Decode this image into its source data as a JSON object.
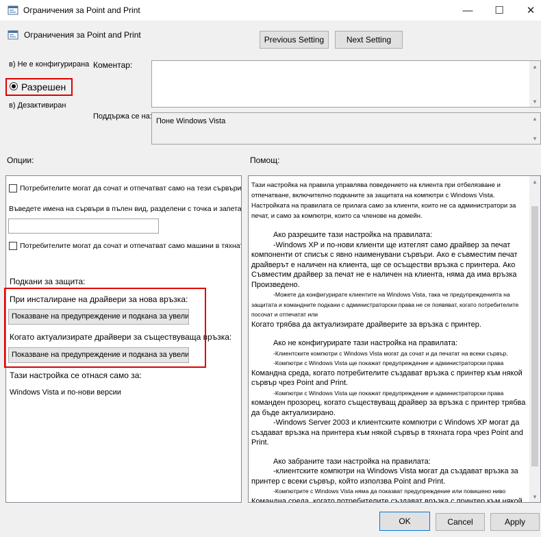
{
  "window": {
    "title": "Ограничения за Point and Print",
    "controls": {
      "minimize": "—",
      "maximize": "☐",
      "close": "✕"
    }
  },
  "header": {
    "setting_name": "Ограничения за Point and Print",
    "previous_label": "Previous Setting",
    "next_label": "Next Setting"
  },
  "state": {
    "not_configured": "в) Не е конфигурирана",
    "enabled": "Разрешен",
    "disabled": "в) Дезактивиран",
    "selected": "enabled"
  },
  "comment": {
    "label": "Коментар:",
    "value": ""
  },
  "supported": {
    "label": "Поддържа се на:",
    "value": "Поне Windows Vista"
  },
  "options": {
    "label": "Опции:",
    "check1": "Потребителите могат да сочат и отпечатват само на тези сървъри:",
    "servers_label": "Въведете имена на сървъри в пълен вид, разделени с точка и запетая",
    "servers_value": "",
    "check2": "Потребителите могат да сочат и отпечатват само машини в тяхната гора",
    "prompts_label": "Подкани за защита:",
    "new_conn_label": "При инсталиране на драйвери за нова връзка:",
    "new_conn_value": "Показване на предупреждение и подкана за увеличаване",
    "update_label": "Когато актуализирате драйвери за съществуваща връзка:",
    "update_value": "Показване на предупреждение и подкана за увеличаване",
    "applies_label": "Тази настройка се отнася само за:",
    "applies_value": "Windows Vista и по-нови версии"
  },
  "help": {
    "label": "Помощ:",
    "lines": [
      {
        "t": "Тази настройка на правила управлява поведението на клиента при отбелязване и отпечатване, включително подканите за защитата на компютри с Windows Vista. Настройката на правилата се прилага само за клиенти, които не са администратори за печат, и само за компютри, които са членове на домейн.",
        "cls": "mixed"
      },
      {
        "t": "Ако разрешите тази настройка на правилата:",
        "cls": "ind"
      },
      {
        "t": "-Windows XP и по-нови клиенти ще изтеглят само драйвер за печат компоненти от списък с явно наименувани сървъри. Ако е съвместим печат драйверът е наличен на клиента, ще се осъществи връзка с принтера. Ако Съвместим драйвер за печат не е наличен на клиента, няма да има връзка Произведено.",
        "cls": "ind1"
      },
      {
        "t": "-Можете да конфигурирате клиентите на Windows Vista, така че предупрежденията на защитата и командните подкани с администраторски права не се появяват, когато потребителите посочат и отпечатат или",
        "cls": "small"
      },
      {
        "t": "Когато трябва да актуализирате драйверите за връзка с принтер.",
        "cls": "plain"
      },
      {
        "t": "Ако не конфигурирате тази настройка на правилата:",
        "cls": "ind"
      },
      {
        "t": "-Клиентските компютри с Windows Vista могат да сочат и да печатат на всеки сървър.",
        "cls": "small-ind"
      },
      {
        "t": "-Компютри с Windows Vista ще покажат предупреждение и администраторски права",
        "cls": "small-ind"
      },
      {
        "t": "Командна среда, когато потребителите създават връзка с принтер към някой сървър чрез Point and Print.",
        "cls": "plain"
      },
      {
        "t": "-Компютри с Windows Vista ще покажат предупреждение и администраторски права",
        "cls": "small-ind"
      },
      {
        "t": "команден прозорец, когато съществуващ драйвер за връзка с принтер трябва да бъде актуализирано.",
        "cls": "plain"
      },
      {
        "t": "-Windows Server 2003 и клиентските компютри с Windows XP могат да създават връзка на принтера към някой сървър в тяхната гора чрез Point and Print.",
        "cls": "ind1"
      },
      {
        "t": "Ако забраните тази настройка на правилата:",
        "cls": "ind"
      },
      {
        "t": "-клиентските компютри на Windows Vista могат да създават връзка за принтер с всеки сървър, който използва Point and Print.",
        "cls": "ind1"
      },
      {
        "t": "-Компютрите с Windows Vista няма да показват предупреждение или повишено ниво",
        "cls": "small-ind"
      },
      {
        "t": "Командна среда, когато потребителите създават връзка с принтер към някой сървър чрез Point and Print.",
        "cls": "plain"
      }
    ]
  },
  "footer": {
    "ok": "OK",
    "cancel": "Cancel",
    "apply": "Apply"
  },
  "colors": {
    "highlight": "#e00000",
    "focus": "#0078d7",
    "panel_bg": "#f0f0f0"
  }
}
